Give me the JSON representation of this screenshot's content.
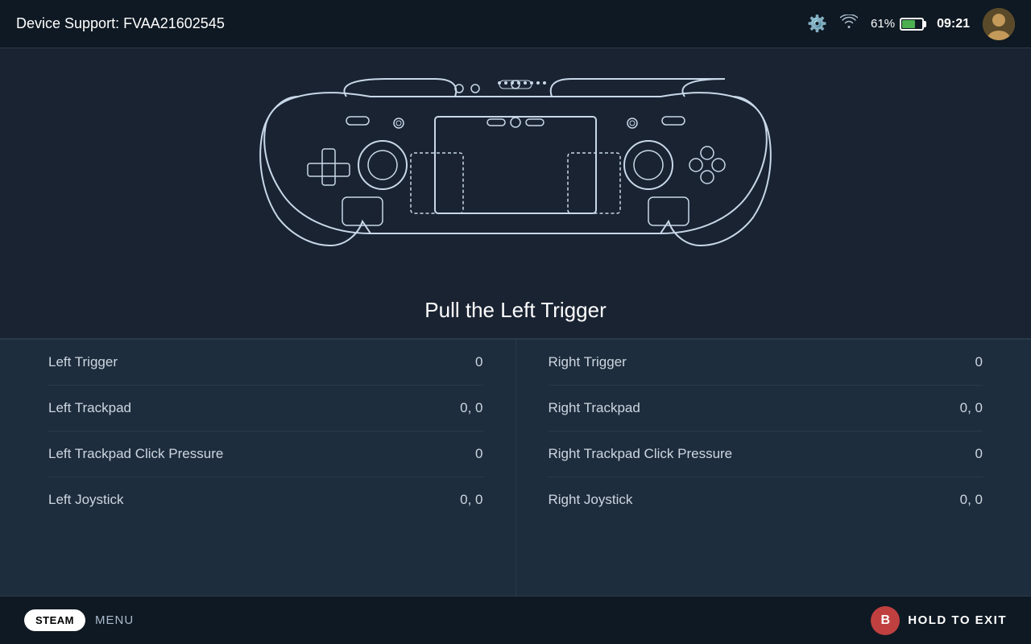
{
  "header": {
    "title": "Device Support: FVAA21602545",
    "battery_percent": "61%",
    "time": "09:21",
    "settings_icon": "⚙",
    "wifi_icon": "📶"
  },
  "controller": {
    "instruction": "Pull the Left Trigger"
  },
  "data": {
    "left": [
      {
        "label": "Left Trigger",
        "value": "0"
      },
      {
        "label": "Left Trackpad",
        "value": "0, 0"
      },
      {
        "label": "Left Trackpad Click Pressure",
        "value": "0"
      },
      {
        "label": "Left Joystick",
        "value": "0, 0"
      }
    ],
    "right": [
      {
        "label": "Right Trigger",
        "value": "0"
      },
      {
        "label": "Right Trackpad",
        "value": "0, 0"
      },
      {
        "label": "Right Trackpad Click Pressure",
        "value": "0"
      },
      {
        "label": "Right Joystick",
        "value": "0, 0"
      }
    ]
  },
  "footer": {
    "steam_label": "STEAM",
    "menu_label": "MENU",
    "b_button_label": "B",
    "hold_to_exit": "HOLD TO EXIT"
  }
}
